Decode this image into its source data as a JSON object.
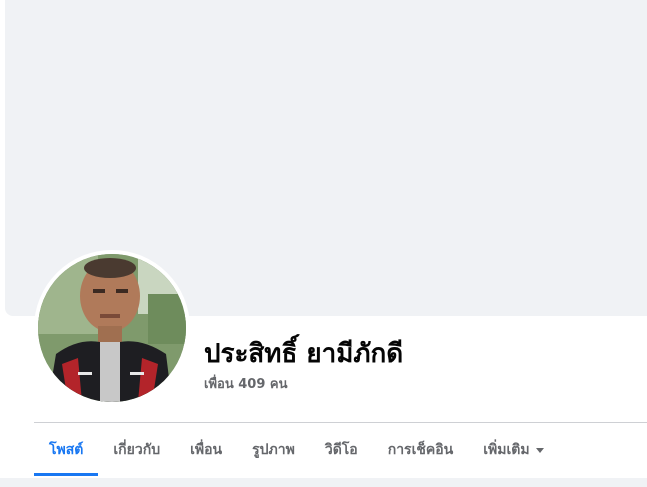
{
  "profile": {
    "name": "ประสิทธิ์ ยามีภักดี",
    "friends_count": "เพื่อน 409 คน"
  },
  "tabs": [
    {
      "label": "โพสต์",
      "active": true
    },
    {
      "label": "เกี่ยวกับ",
      "active": false
    },
    {
      "label": "เพื่อน",
      "active": false
    },
    {
      "label": "รูปภาพ",
      "active": false
    },
    {
      "label": "วิดีโอ",
      "active": false
    },
    {
      "label": "การเช็คอิน",
      "active": false
    },
    {
      "label": "เพิ่มเติม",
      "active": false
    }
  ],
  "colors": {
    "accent": "#1877f2",
    "cover": "#f0f2f5",
    "muted_text": "#65676b",
    "name_text": "#050505"
  },
  "icons": {
    "more_dropdown": "caret-down-icon"
  }
}
